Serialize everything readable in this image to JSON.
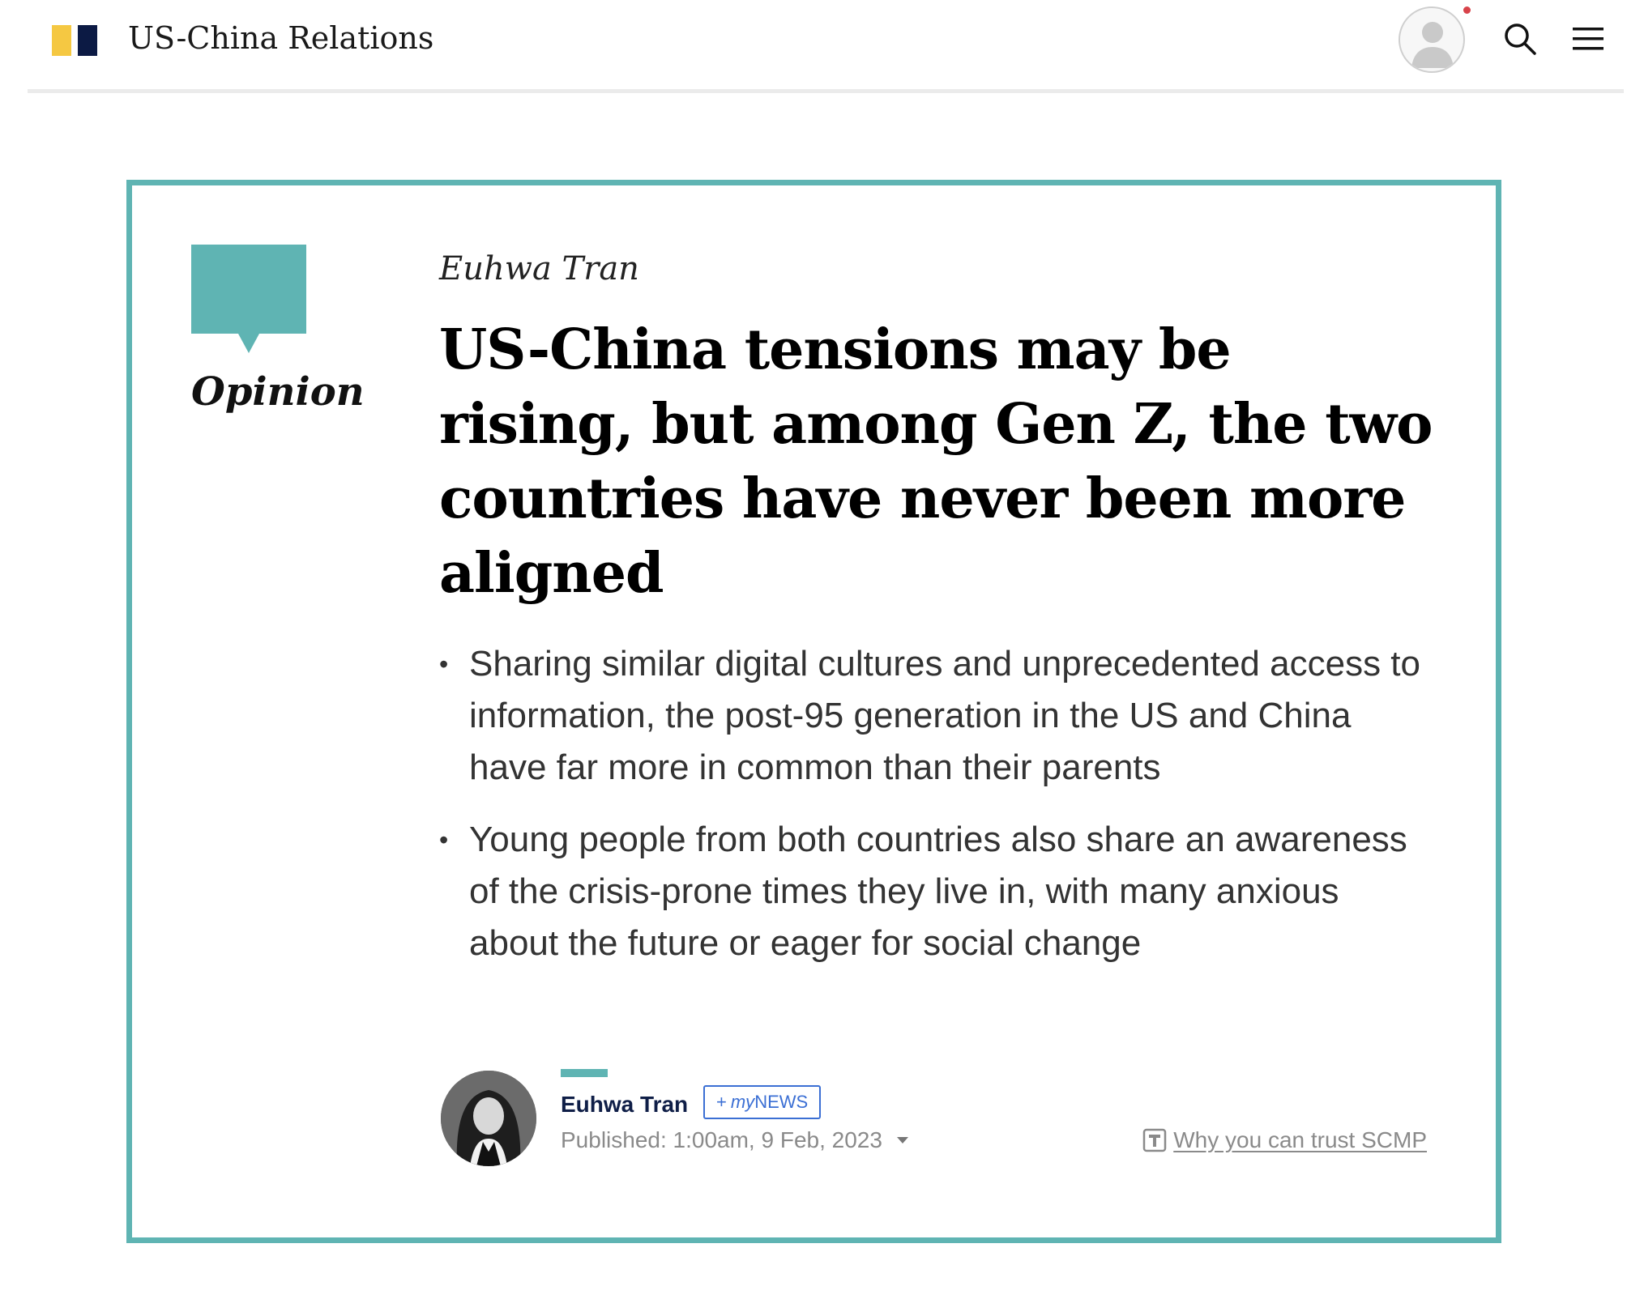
{
  "header": {
    "section_title": "US-China Relations",
    "brand_colors": {
      "yellow": "#f5c842",
      "navy": "#0c1a44"
    },
    "icons": {
      "account": "user-avatar-icon",
      "search": "search-icon",
      "menu": "hamburger-menu-icon"
    },
    "notification_dot_color": "#d8434a"
  },
  "article": {
    "accent_color": "#5fb4b3",
    "category": "Opinion",
    "author": "Euhwa Tran",
    "headline": "US-China tensions may be rising, but among Gen Z, the two countries have never been more aligned",
    "summary": [
      "Sharing similar digital cultures and unprecedented access to information, the post-95 generation in the US and China have far more in common than their parents",
      "Young people from both countries also share an awareness of the crisis-prone times they live in, with many anxious about the future or eager for social change"
    ],
    "byline": {
      "name": "Euhwa Tran",
      "follow_button": {
        "plus": "+",
        "my": "my",
        "news": "NEWS"
      },
      "published": "Published: 1:00am, 9 Feb, 2023",
      "trust_link": "Why you can trust SCMP"
    }
  }
}
